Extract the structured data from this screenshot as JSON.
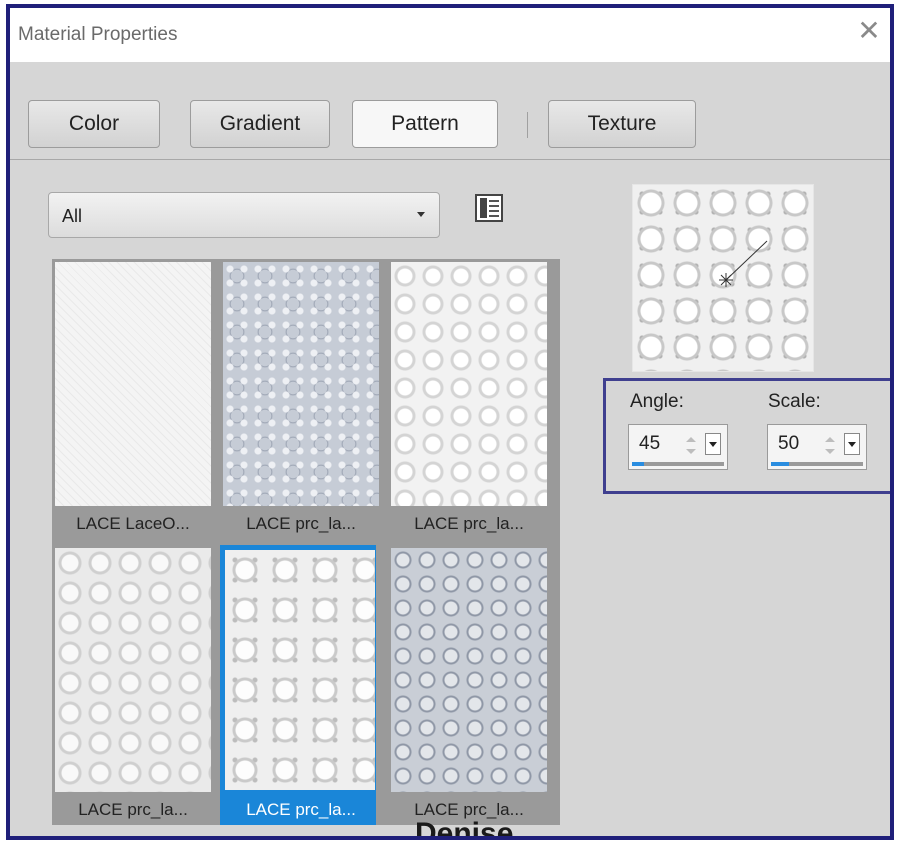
{
  "dialog": {
    "title": "Material Properties",
    "close_glyph": "✕"
  },
  "tabs": [
    {
      "label": "Color",
      "active": false
    },
    {
      "label": "Gradient",
      "active": false
    },
    {
      "label": "Pattern",
      "active": true
    },
    {
      "label": "Texture",
      "active": false
    }
  ],
  "category": {
    "selected": "All"
  },
  "view_icon": "list-view-icon",
  "patterns": [
    {
      "label": "LACE LaceO...",
      "selected": false
    },
    {
      "label": "LACE prc_la...",
      "selected": false
    },
    {
      "label": "LACE prc_la...",
      "selected": false
    },
    {
      "label": "LACE prc_la...",
      "selected": false
    },
    {
      "label": "LACE prc_la...",
      "selected": true
    },
    {
      "label": "LACE prc_la...",
      "selected": false
    }
  ],
  "angle": {
    "label": "Angle:",
    "value": "45",
    "level": 0.125
  },
  "scale": {
    "label": "Scale:",
    "value": "50",
    "level": 0.2
  },
  "watermark": "Denise",
  "colors": {
    "accent": "#1a86d8",
    "frame": "#1f1f7a",
    "highlight": "#3f3f8f"
  }
}
